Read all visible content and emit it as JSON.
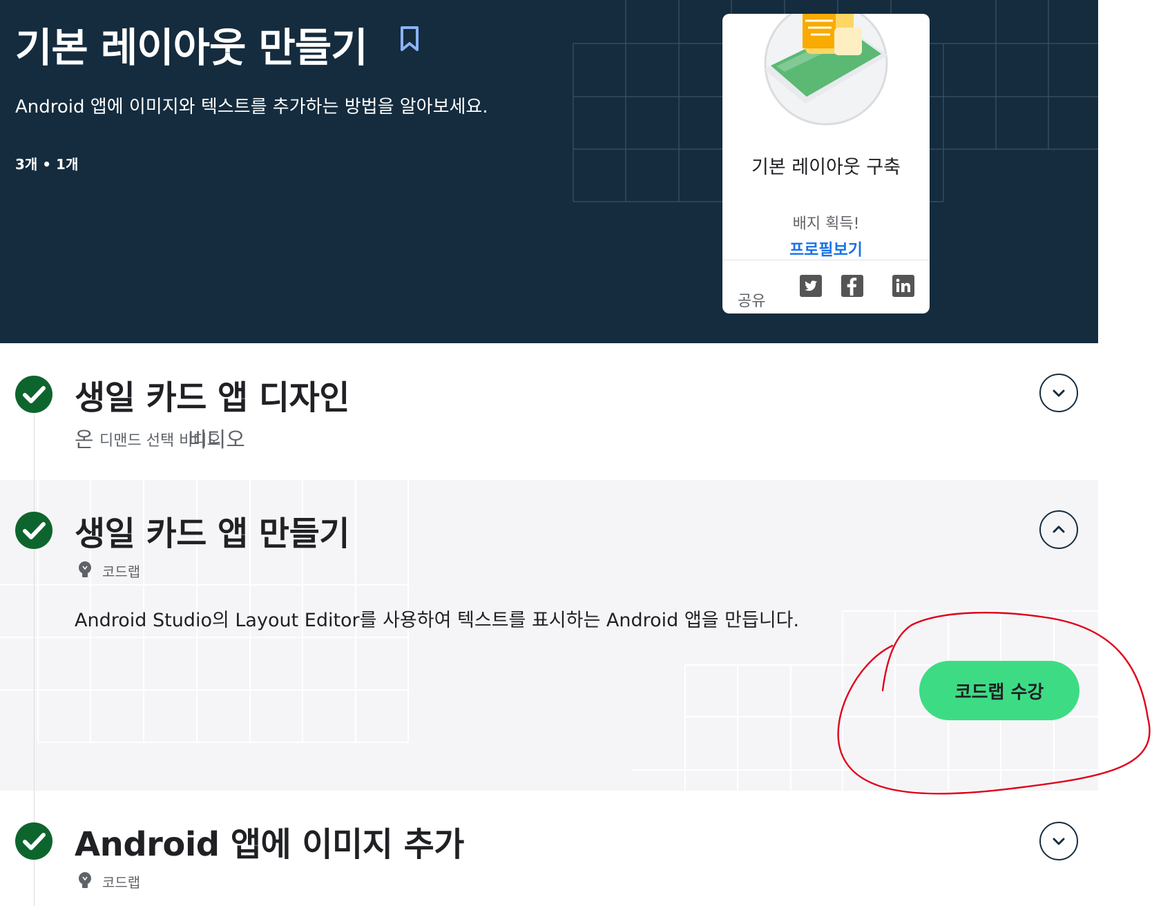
{
  "header": {
    "title": "기본 레이아웃 만들기",
    "subtitle": "Android 앱에 이미지와 텍스트를 추가하는 방법을 알아보세요.",
    "meta": "3개 • 1개"
  },
  "badge": {
    "name": "기본 레이아웃 구축",
    "earned": "배지 획득!",
    "profile_link": "프로필보기",
    "share_label": "공유",
    "social_icons": [
      "twitter-icon",
      "facebook-icon",
      "linkedin-icon"
    ]
  },
  "steps": [
    {
      "title": "생일 카드 앱 디자인",
      "type_overlap": [
        "온",
        "디맨드 선택 비디오",
        "비디오"
      ],
      "expanded": false,
      "completed": true
    },
    {
      "title": "생일 카드 앱 만들기",
      "type": "코드랩",
      "description": "Android Studio의 Layout Editor를 사용하여 텍스트를 표시하는 Android 앱을 만듭니다.",
      "cta_label": "코드랩 수강",
      "expanded": true,
      "completed": true
    },
    {
      "title": "Android 앱에 이미지 추가",
      "type": "코드랩",
      "expanded": false,
      "completed": true
    }
  ],
  "colors": {
    "hero_bg": "#152c3e",
    "check_green": "#0d652d",
    "cta_green": "#3ddc84",
    "link_blue": "#1a73e8",
    "annotation_red": "#e0001a"
  }
}
